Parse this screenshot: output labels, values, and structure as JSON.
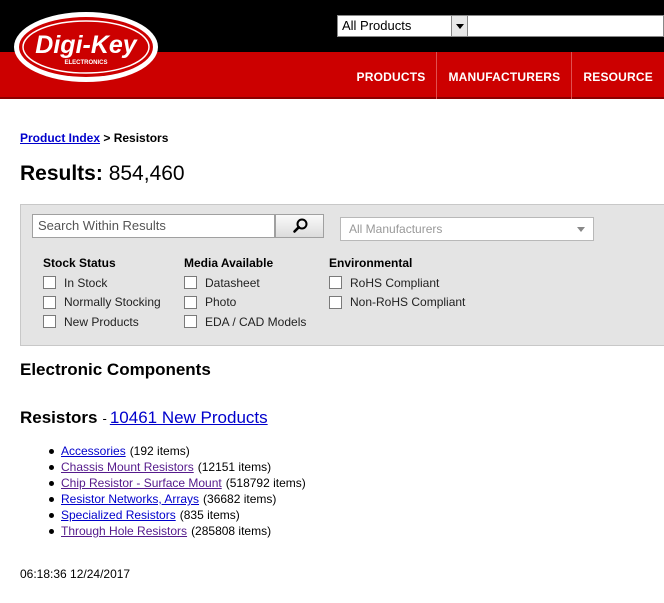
{
  "header": {
    "logo_text": "Digi-Key",
    "logo_subtext": "ELECTRONICS",
    "search_scope": "All Products",
    "nav": [
      "PRODUCTS",
      "MANUFACTURERS",
      "RESOURCE"
    ]
  },
  "breadcrumb": {
    "link": "Product Index",
    "separator": " > ",
    "current": "Resistors"
  },
  "results": {
    "label": "Results:",
    "count": "854,460"
  },
  "filters": {
    "search_placeholder": "Search Within Results",
    "manufacturers_placeholder": "All Manufacturers",
    "groups": [
      {
        "title": "Stock Status",
        "options": [
          "In Stock",
          "Normally Stocking",
          "New Products"
        ]
      },
      {
        "title": "Media Available",
        "options": [
          "Datasheet",
          "Photo",
          "EDA / CAD Models"
        ]
      },
      {
        "title": "Environmental",
        "options": [
          "RoHS Compliant",
          "Non-RoHS Compliant"
        ]
      }
    ]
  },
  "section_title": "Electronic Components",
  "category": {
    "title": "Resistors",
    "separator": "-",
    "new_products_link": "10461 New Products",
    "items": [
      {
        "name": "Accessories",
        "count": "(192 items)"
      },
      {
        "name": "Chassis Mount Resistors",
        "count": "(12151 items)"
      },
      {
        "name": "Chip Resistor - Surface Mount",
        "count": "(518792 items)"
      },
      {
        "name": "Resistor Networks, Arrays",
        "count": "(36682 items)"
      },
      {
        "name": "Specialized Resistors",
        "count": "(835 items)"
      },
      {
        "name": "Through Hole Resistors",
        "count": "(285808 items)"
      }
    ]
  },
  "timestamp": "06:18:36 12/24/2017",
  "colors": {
    "brand_red": "#cc0000",
    "link_blue": "#0000cc",
    "link_visited": "#551a8b"
  }
}
